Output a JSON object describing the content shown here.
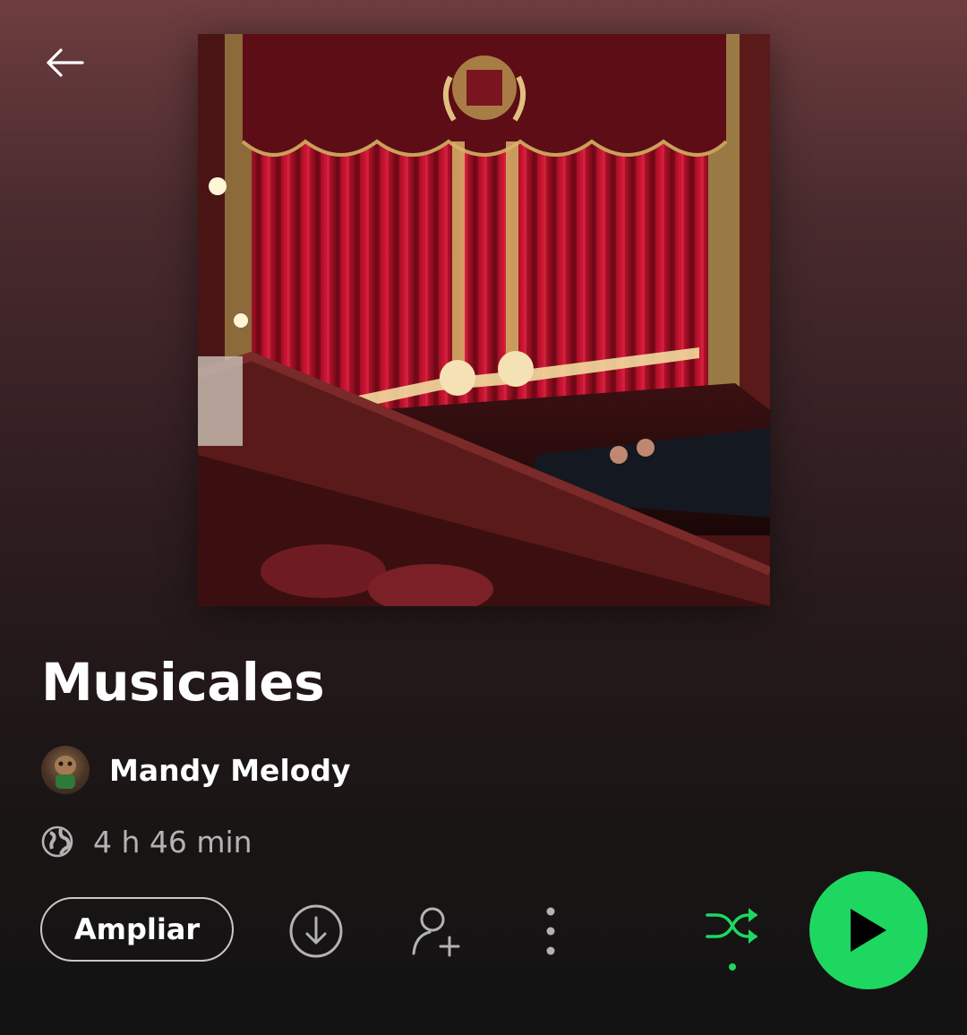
{
  "header": {
    "back_icon": "arrow-left-icon"
  },
  "playlist": {
    "cover_alt": "Playlist cover: theatre stage with red curtain",
    "title": "Musicales",
    "owner_name": "Mandy Melody",
    "visibility_icon": "globe-icon",
    "duration": "4 h 46 min"
  },
  "actions": {
    "expand_label": "Ampliar",
    "download_icon": "download-icon",
    "add_user_icon": "add-user-icon",
    "more_icon": "more-vertical-icon",
    "shuffle_icon": "shuffle-icon",
    "play_icon": "play-icon"
  },
  "colors": {
    "accent": "#1ed760",
    "text_secondary": "#b3b3b3"
  }
}
